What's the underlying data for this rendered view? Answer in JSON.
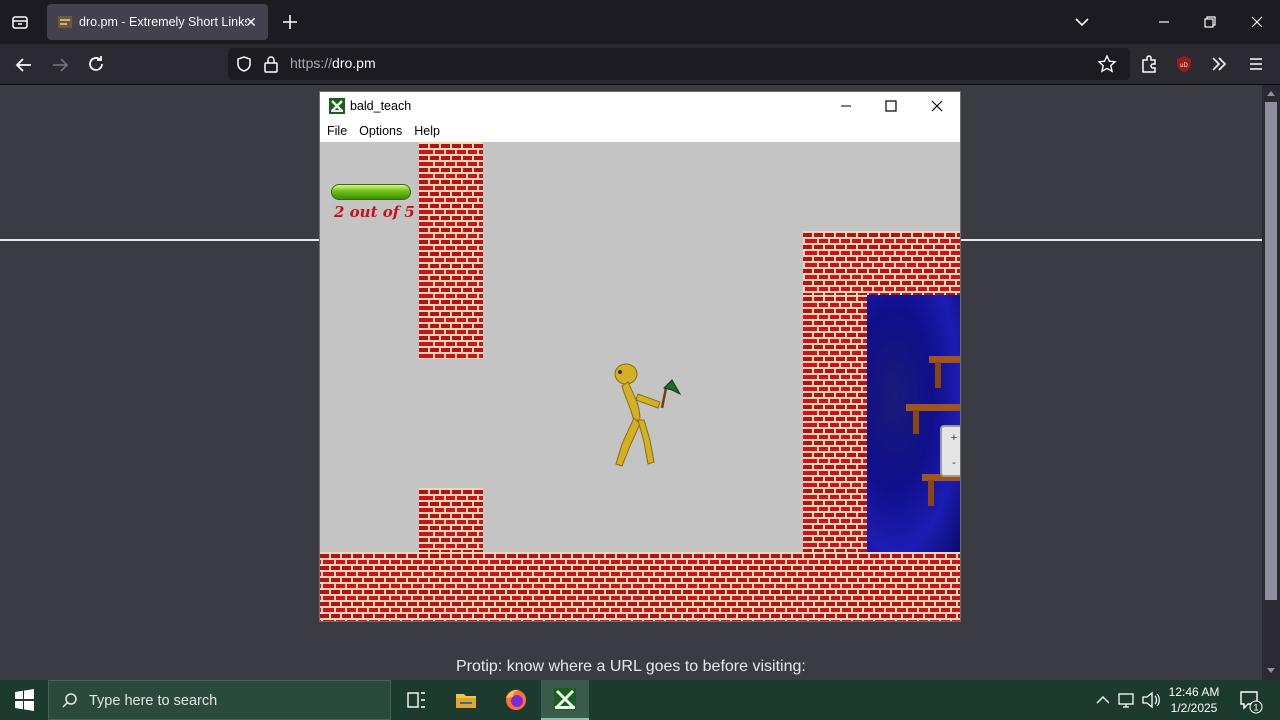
{
  "browser": {
    "tab_title": "dro.pm - Extremely Short Links",
    "tab_close": "✕",
    "url_scheme": "https://",
    "url_host": "dro.pm",
    "ublock_badge": "uD"
  },
  "game_window": {
    "title": "bald_teach",
    "menu": [
      "File",
      "Options",
      "Help"
    ],
    "hud": {
      "progress_text": "2 out of 5",
      "health_fraction": 1.0
    },
    "zoom": {
      "plus": "+",
      "minus": "-"
    }
  },
  "page": {
    "protip": "Protip: know where a URL goes to before visiting:"
  },
  "taskbar": {
    "search_placeholder": "Type here to search",
    "time": "12:46 AM",
    "date": "1/2/2025",
    "notification_count": "1"
  },
  "colors": {
    "accent_green": "#6cc119",
    "brick_red": "#b0131c",
    "mortar": "#f4d6b0",
    "water_blue": "#1c1cb3",
    "taskbar": "#1d3a2e"
  }
}
